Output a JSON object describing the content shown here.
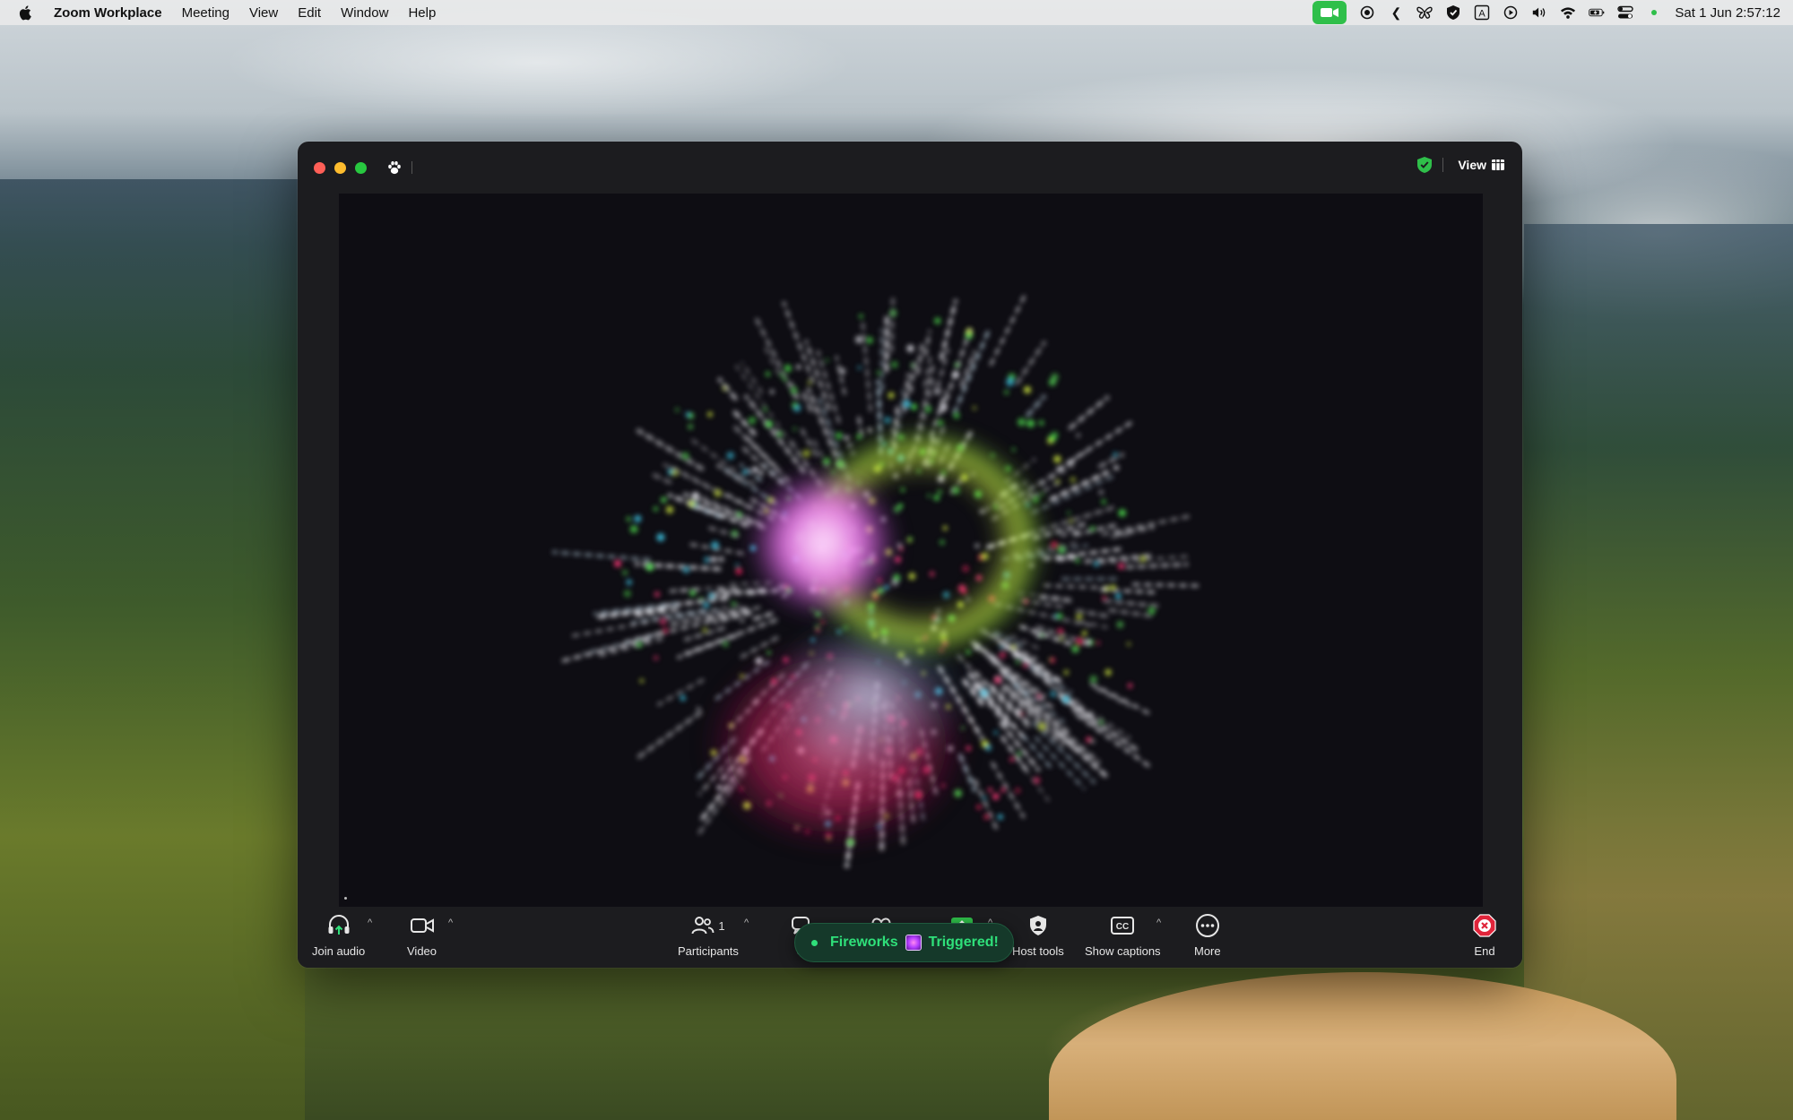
{
  "menubar": {
    "app_name": "Zoom Workplace",
    "items": [
      "Meeting",
      "View",
      "Edit",
      "Window",
      "Help"
    ],
    "clock": "Sat 1 Jun  2:57:12"
  },
  "window": {
    "view_label": "View"
  },
  "toolbar": {
    "join_audio": "Join audio",
    "video": "Video",
    "participants": "Participants",
    "participants_count": "1",
    "chat_partial": "C",
    "host_tools": "Host tools",
    "show_captions": "Show captions",
    "more": "More",
    "end": "End"
  },
  "toast": {
    "text_before": "Fireworks",
    "text_after": "Triggered!"
  },
  "colors": {
    "zoom_green": "#2fbf4a",
    "toast_text": "#2fe07a",
    "end_red": "#e0243a",
    "window_bg": "#1c1c1f"
  }
}
